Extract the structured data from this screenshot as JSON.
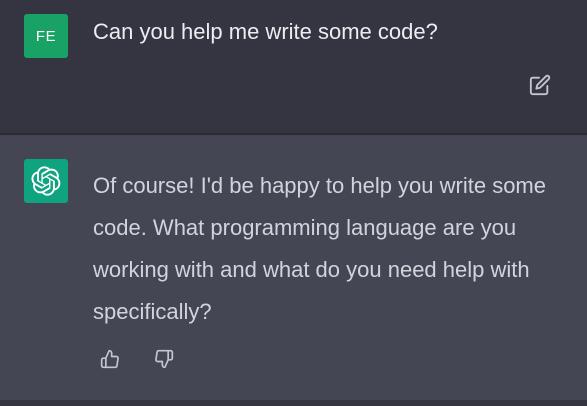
{
  "conversation": {
    "user_message": {
      "avatar_initials": "FE",
      "text": "Can you help me write some code?",
      "edit_icon": "edit-icon"
    },
    "assistant_message": {
      "avatar_icon": "openai-logo-icon",
      "text": "Of course! I'd be happy to help you write some code. What programming language are you working with and what do you need help with specifically?",
      "feedback": {
        "thumbs_up_icon": "thumbs-up-icon",
        "thumbs_down_icon": "thumbs-down-icon"
      }
    }
  },
  "colors": {
    "user_bg": "#343541",
    "assistant_bg": "#444654",
    "user_avatar": "#19a265",
    "assistant_avatar": "#10a37f"
  }
}
